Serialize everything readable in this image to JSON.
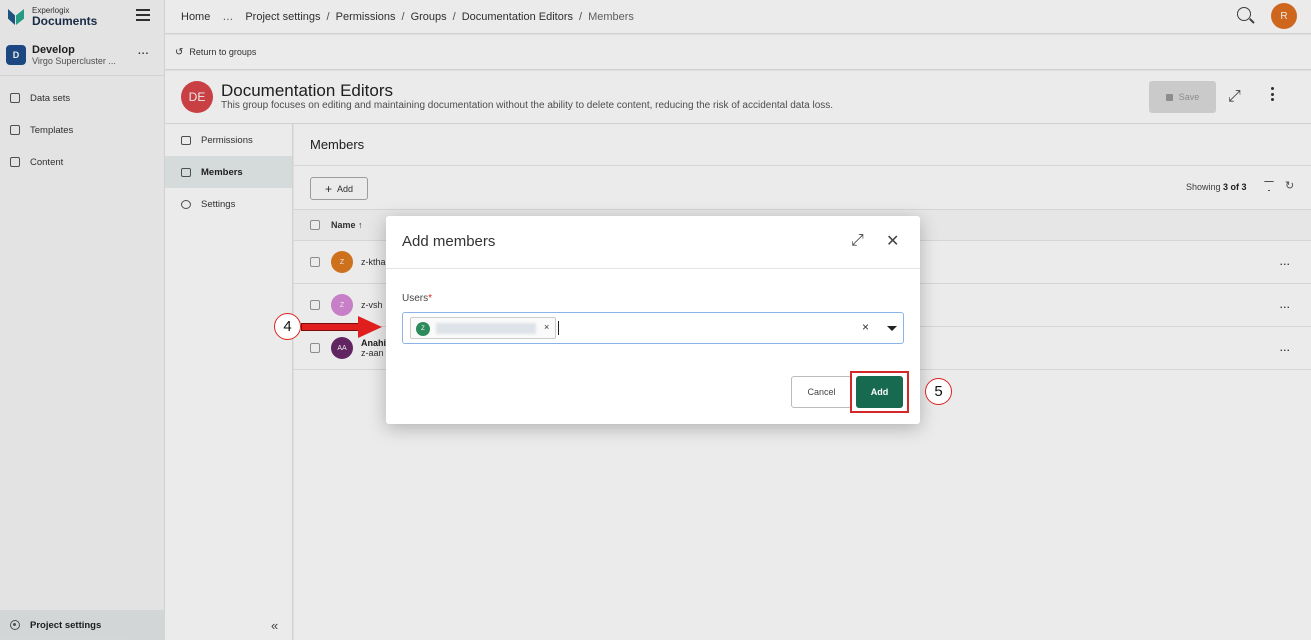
{
  "brand": {
    "small": "Experlogix",
    "big": "Documents"
  },
  "workspace": {
    "badge": "D",
    "name": "Develop",
    "sub": "Virgo Supercluster ...",
    "more": "..."
  },
  "sidebar": {
    "items": [
      {
        "label": "Data sets"
      },
      {
        "label": "Templates"
      },
      {
        "label": "Content"
      }
    ],
    "bottom_label": "Project settings",
    "collapse": "«"
  },
  "breadcrumb": {
    "home": "Home",
    "ellipsis": "…",
    "items": [
      "Project settings",
      "Permissions",
      "Groups",
      "Documentation Editors"
    ],
    "current": "Members"
  },
  "user_avatar": "R",
  "return_label": "Return to groups",
  "group": {
    "initials": "DE",
    "title": "Documentation Editors",
    "description": "This group focuses on editing and maintaining documentation without the ability to delete content, reducing the risk of accidental data loss.",
    "save_label": "Save"
  },
  "group_nav": [
    {
      "label": "Permissions"
    },
    {
      "label": "Members"
    },
    {
      "label": "Settings"
    }
  ],
  "members": {
    "title": "Members",
    "add_label": "Add",
    "showing_prefix": "Showing",
    "showing_count": "3 of 3",
    "column_name": "Name ↑",
    "rows": [
      {
        "initial": "Z",
        "name": "z-ktha",
        "color": "#e07b20"
      },
      {
        "initial": "Z",
        "name": "z-vsh",
        "color": "#d88ad8"
      },
      {
        "initial": "AA",
        "name": "Anahi",
        "sub": "z-aan",
        "color": "#6a2a6a"
      }
    ],
    "row_more": "..."
  },
  "dialog": {
    "title": "Add members",
    "users_label": "Users",
    "required_mark": "*",
    "chip_initial": "Z",
    "chip_remove": "×",
    "clear": "×",
    "cancel_label": "Cancel",
    "add_label": "Add"
  },
  "callouts": {
    "step4": "4",
    "step5": "5"
  },
  "colors": {
    "accent": "#17694f",
    "danger": "#d62828",
    "group_avatar": "#d9454a",
    "user_avatar": "#e07020"
  }
}
